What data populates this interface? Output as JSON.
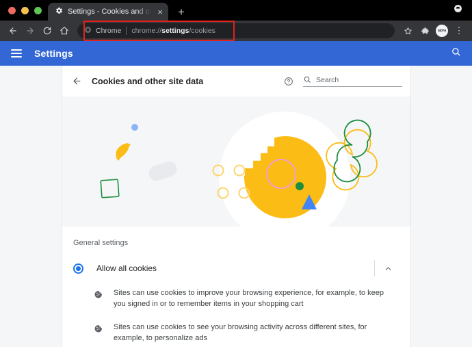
{
  "browser": {
    "traffic_lights": [
      "close",
      "minimize",
      "maximize"
    ],
    "tab": {
      "favicon": "gear-icon",
      "title": "Settings - Cookies and other s",
      "close_label": "×"
    },
    "new_tab_label": "+",
    "toolbar": {
      "back_label": "←",
      "forward_label": "→",
      "reload_label": "C",
      "home_label": "⌂",
      "omnibox": {
        "chip_label": "Chrome",
        "url_prefix": "chrome://",
        "url_bold": "settings",
        "url_suffix": "/cookies"
      },
      "bookmark_label": "☆",
      "extensions_label": "puzzle-piece",
      "avatar_text": "alpha",
      "menu_label": "⋮"
    },
    "highlight_color": "#e22319"
  },
  "settings_bar": {
    "menu_label": "menu",
    "title": "Settings",
    "search_label": "search"
  },
  "page": {
    "back_label": "back",
    "title": "Cookies and other site data",
    "help_label": "help",
    "search": {
      "icon": "search-icon",
      "placeholder": "Search",
      "value": ""
    }
  },
  "illustration": {
    "name": "cookie-illustration",
    "colors": {
      "cookie": "#fbbc15",
      "blue_dot": "#8ab4f8",
      "green_outline": "#1e8e3e",
      "pink_outline": "#f09ae9",
      "green_dot": "#1e8e3e",
      "blue_triangle": "#4285f4",
      "gray_pill": "#e8eaed",
      "background": "#f5f6f7"
    }
  },
  "general_settings": {
    "section_label": "General settings",
    "option": {
      "label": "Allow all cookies",
      "selected": true,
      "expanded": true,
      "chevron": "chevron-up-icon"
    },
    "descriptions": [
      "Sites can use cookies to improve your browsing experience, for example, to keep you signed in or to remember items in your shopping cart",
      "Sites can use cookies to see your browsing activity across different sites, for example, to personalize ads"
    ]
  },
  "accent_colors": {
    "settings_bar_blue": "#3367d6",
    "radio_blue": "#1a73e8",
    "tab_bg": "#35363a",
    "toolbar_bg": "#35363a",
    "omnibox_bg": "#202124"
  }
}
